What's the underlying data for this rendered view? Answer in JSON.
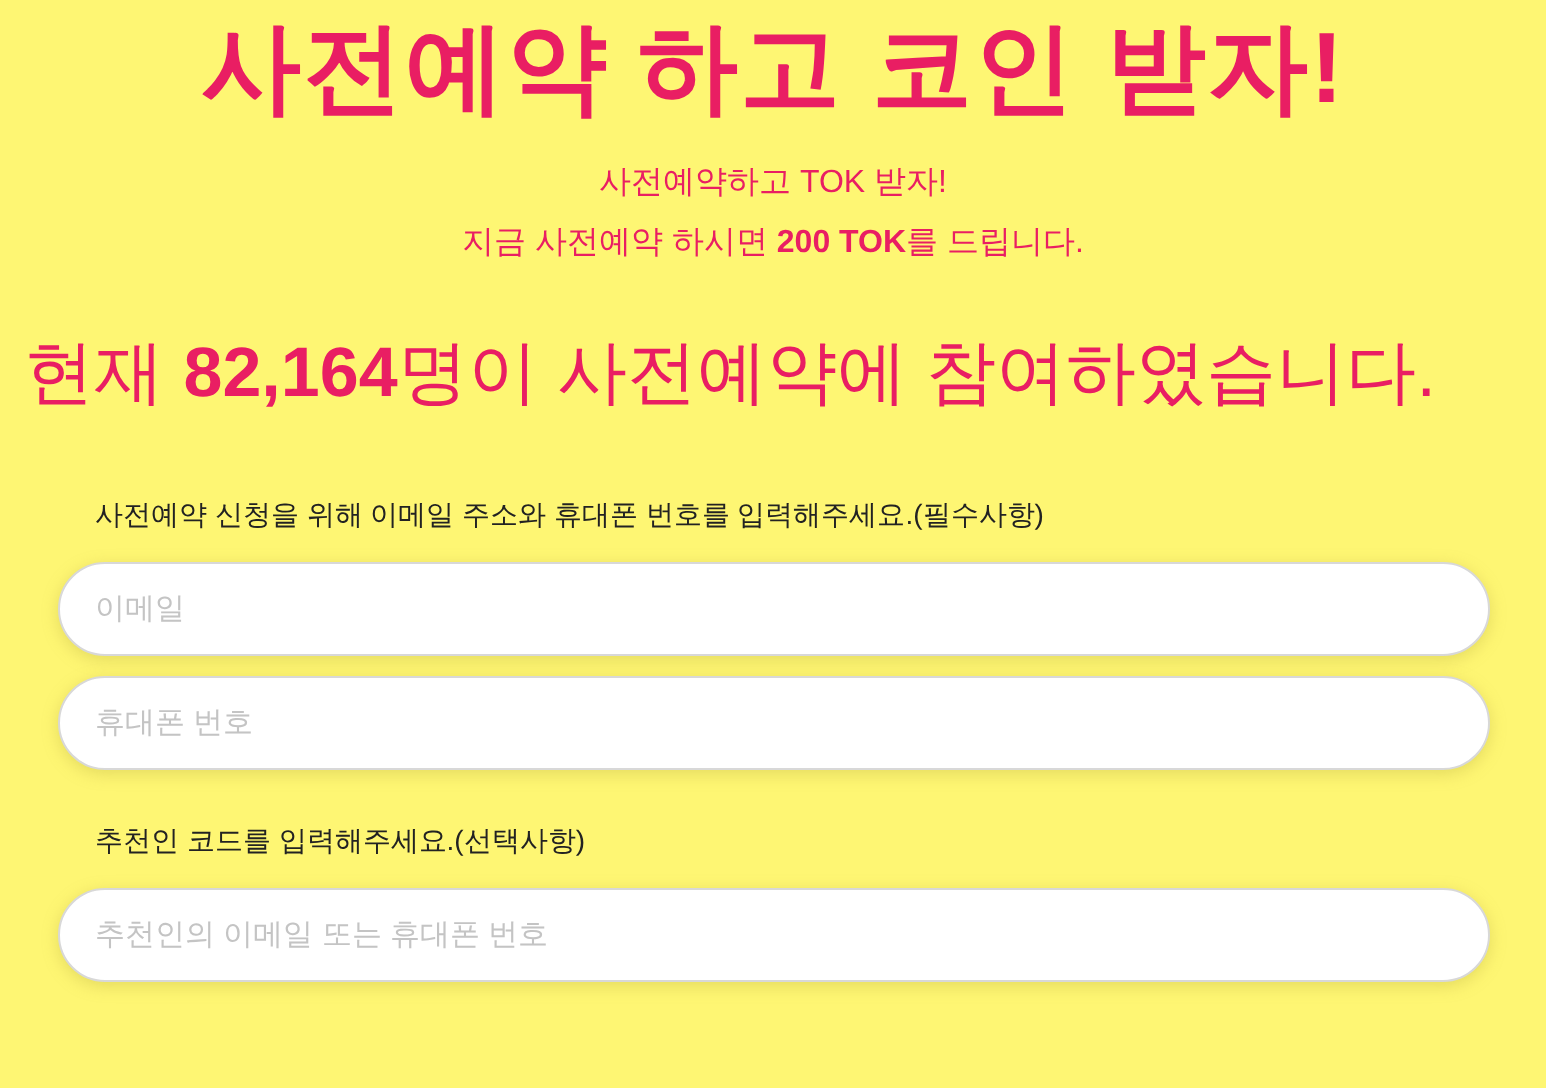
{
  "headline": "사전예약 하고 코인 받자!",
  "intro": [
    "사전예약하고 TOK 받자!",
    "지금 사전예약 하시면 **200 TOK**를 드립니다."
  ],
  "counter": "현재 **82,164**명이 사전예약에 참여하였습니다.",
  "sections": [
    {
      "label": "사전예약 신청을 위해 이메일 주소와 휴대폰 번호를 입력해주세요.(필수사항)",
      "fields": [
        {
          "placeholder": "이메일"
        },
        {
          "placeholder": "휴대폰 번호"
        }
      ]
    },
    {
      "label": "추천인 코드를 입력해주세요.(선택사항)",
      "fields": [
        {
          "placeholder": "추천인의 이메일 또는 휴대폰 번호"
        }
      ]
    }
  ]
}
